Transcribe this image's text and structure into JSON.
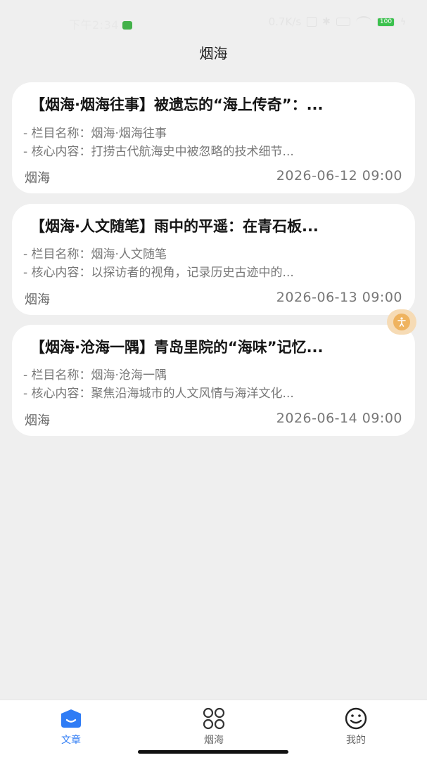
{
  "status_bar": {
    "time": "下午2:34",
    "net_speed": "0.7K/s",
    "battery": "100"
  },
  "header": {
    "title": "烟海"
  },
  "articles": [
    {
      "title": "【烟海·烟海往事】被遗忘的“海上传奇”：...",
      "column": "- 栏目名称：烟海·烟海往事",
      "summary": "- 核心内容：打捞古代航海史中被忽略的技术细节...",
      "source": "烟海",
      "date": "2026-06-12 09:00"
    },
    {
      "title": "【烟海·人文随笔】雨中的平遥：在青石板...",
      "column": "- 栏目名称：烟海·人文随笔",
      "summary": "- 核心内容：以探访者的视角，记录历史古迹中的...",
      "source": "烟海",
      "date": "2026-06-13 09:00"
    },
    {
      "title": "【烟海·沧海一隅】青岛里院的“海味”记忆...",
      "column": "- 栏目名称：烟海·沧海一隅",
      "summary": "- 核心内容：聚焦沿海城市的人文风情与海洋文化...",
      "source": "烟海",
      "date": "2026-06-14 09:00"
    }
  ],
  "floating_button": {
    "icon": "accessibility-icon"
  },
  "tabbar": {
    "tabs": [
      {
        "label": "文章",
        "icon": "article-icon",
        "active": true
      },
      {
        "label": "烟海",
        "icon": "grid-icon",
        "active": false
      },
      {
        "label": "我的",
        "icon": "smiley-icon",
        "active": false
      }
    ]
  },
  "colors": {
    "accent": "#2f7cf5",
    "background": "#efefef",
    "card": "#ffffff",
    "float_button": "#efb35f"
  }
}
